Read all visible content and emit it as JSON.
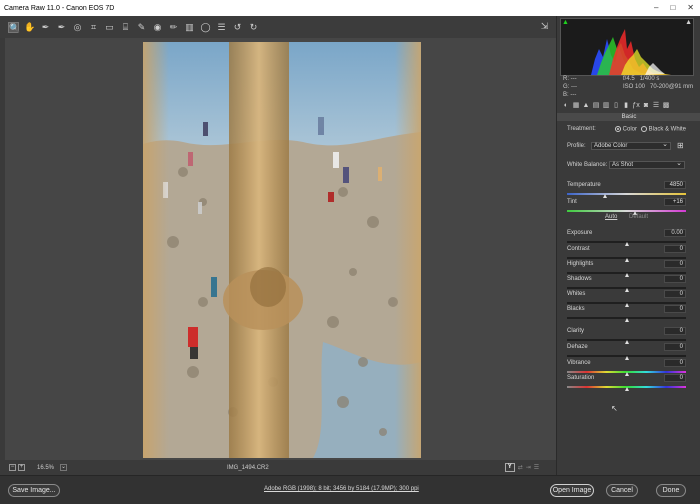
{
  "window": {
    "title": "Camera Raw 11.0  -  Canon EOS 7D",
    "controls": [
      "–",
      "□",
      "✕"
    ]
  },
  "toolbar": {
    "tools": [
      {
        "name": "zoom-tool-icon",
        "glyph": "🔍",
        "active": true
      },
      {
        "name": "hand-tool-icon",
        "glyph": "✋"
      },
      {
        "name": "white-balance-tool-icon",
        "glyph": "✒"
      },
      {
        "name": "color-sampler-tool-icon",
        "glyph": "✒"
      },
      {
        "name": "targeted-adjustment-tool-icon",
        "glyph": "◎"
      },
      {
        "name": "crop-tool-icon",
        "glyph": "⌗"
      },
      {
        "name": "straighten-tool-icon",
        "glyph": "▭"
      },
      {
        "name": "transform-tool-icon",
        "glyph": "⌸"
      },
      {
        "name": "spot-removal-tool-icon",
        "glyph": "✎"
      },
      {
        "name": "red-eye-tool-icon",
        "glyph": "◉"
      },
      {
        "name": "adjustment-brush-icon",
        "glyph": "✏"
      },
      {
        "name": "graduated-filter-icon",
        "glyph": "▥"
      },
      {
        "name": "radial-filter-icon",
        "glyph": "◯"
      },
      {
        "name": "preferences-icon",
        "glyph": "☰"
      },
      {
        "name": "rotate-left-icon",
        "glyph": "↺"
      },
      {
        "name": "rotate-right-icon",
        "glyph": "↻"
      }
    ],
    "fullscreen_glyph": "⇲"
  },
  "info": {
    "zoom": "16.5%",
    "filename": "IMG_1494.CR2",
    "preview_label": "Y"
  },
  "readout": {
    "r_label": "R:",
    "g_label": "G:",
    "b_label": "B:",
    "r": "---",
    "g": "---",
    "b": "---",
    "aperture": "f/4.5",
    "shutter": "1/400 s",
    "iso": "ISO 100",
    "lens": "70-200@91 mm"
  },
  "panel": {
    "header": "Basic",
    "treatment_label": "Treatment:",
    "color_label": "Color",
    "bw_label": "Black & White",
    "profile_label": "Profile:",
    "profile_value": "Adobe Color",
    "wb_label": "White Balance:",
    "wb_value": "As Shot",
    "auto_label": "Auto",
    "default_label": "Default",
    "sliders": [
      {
        "label": "Temperature",
        "value": "4850",
        "pos": 0.32
      },
      {
        "label": "Tint",
        "value": "+16",
        "pos": 0.57
      },
      {
        "label": "Exposure",
        "value": "0.00",
        "pos": 0.5
      },
      {
        "label": "Contrast",
        "value": "0",
        "pos": 0.5
      },
      {
        "label": "Highlights",
        "value": "0",
        "pos": 0.5
      },
      {
        "label": "Shadows",
        "value": "0",
        "pos": 0.5
      },
      {
        "label": "Whites",
        "value": "0",
        "pos": 0.5
      },
      {
        "label": "Blacks",
        "value": "0",
        "pos": 0.5
      },
      {
        "label": "Clarity",
        "value": "0",
        "pos": 0.5
      },
      {
        "label": "Dehaze",
        "value": "0",
        "pos": 0.5
      },
      {
        "label": "Vibrance",
        "value": "0",
        "pos": 0.5
      },
      {
        "label": "Saturation",
        "value": "0",
        "pos": 0.5
      }
    ]
  },
  "footer": {
    "save_label": "Save Image...",
    "workflow_link": "Adobe RGB (1998); 8 bit; 3456 by 5184 (17.9MP); 300 ppi",
    "open_label": "Open Image",
    "cancel_label": "Cancel",
    "done_label": "Done"
  },
  "colors": {
    "accent": "#d0d0d0",
    "panel_bg": "#3a3a3a",
    "canvas_bg": "#464646"
  }
}
